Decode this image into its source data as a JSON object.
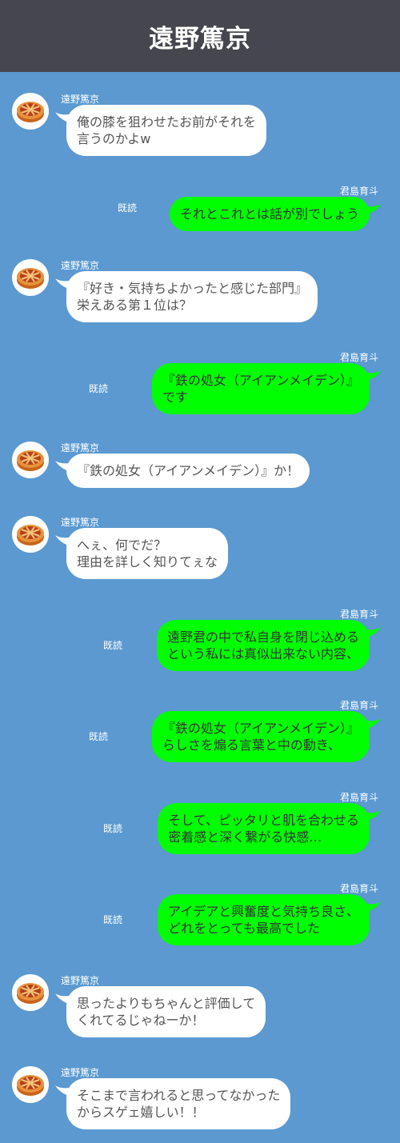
{
  "header": {
    "title": "遠野篤京"
  },
  "colors": {
    "header_bg": "#46464e",
    "chat_bg": "#5b99d0",
    "self_bubble": "#00ff00",
    "other_bubble": "#ffffff"
  },
  "messages": [
    {
      "sender": "遠野篤京",
      "avatar_icon": "pie-icon",
      "lines": [
        "俺の膝を狙わせたお前がそれを",
        "言うのかよw"
      ]
    },
    {
      "sender": "君島育斗",
      "read": "既読",
      "lines": [
        "それとこれとは話が別でしょう"
      ]
    },
    {
      "sender": "遠野篤京",
      "avatar_icon": "pie-icon",
      "lines": [
        "『好き・気持ちよかったと感じた部門』",
        "栄えある第１位は？"
      ]
    },
    {
      "sender": "君島育斗",
      "read": "既読",
      "lines": [
        "『鉄の処女（アイアンメイデン）』",
        "です"
      ]
    },
    {
      "sender": "遠野篤京",
      "avatar_icon": "pie-icon",
      "lines": [
        "『鉄の処女（アイアンメイデン）』か！"
      ]
    },
    {
      "sender": "遠野篤京",
      "avatar_icon": "pie-icon",
      "lines": [
        "へぇ、何でだ？",
        "理由を詳しく知りてぇな"
      ]
    },
    {
      "sender": "君島育斗",
      "read": "既読",
      "lines": [
        "遠野君の中で私自身を閉じ込める",
        "という私には真似出来ない内容、"
      ]
    },
    {
      "sender": "君島育斗",
      "read": "既読",
      "lines": [
        "『鉄の処女（アイアンメイデン）』",
        "らしさを煽る言葉と中の動き、"
      ]
    },
    {
      "sender": "君島育斗",
      "read": "既読",
      "lines": [
        "そして、ピッタリと肌を合わせる",
        "密着感と深く繋がる快感…"
      ]
    },
    {
      "sender": "君島育斗",
      "read": "既読",
      "lines": [
        "アイデアと興奮度と気持ち良さ、",
        "どれをとっても最高でした"
      ]
    },
    {
      "sender": "遠野篤京",
      "avatar_icon": "pie-icon",
      "lines": [
        "思ったよりもちゃんと評価して",
        "くれてるじゃねーか！"
      ]
    },
    {
      "sender": "遠野篤京",
      "avatar_icon": "pie-icon",
      "lines": [
        "そこまで言われると思ってなかった",
        "からスゲェ嬉しい！！"
      ]
    }
  ]
}
